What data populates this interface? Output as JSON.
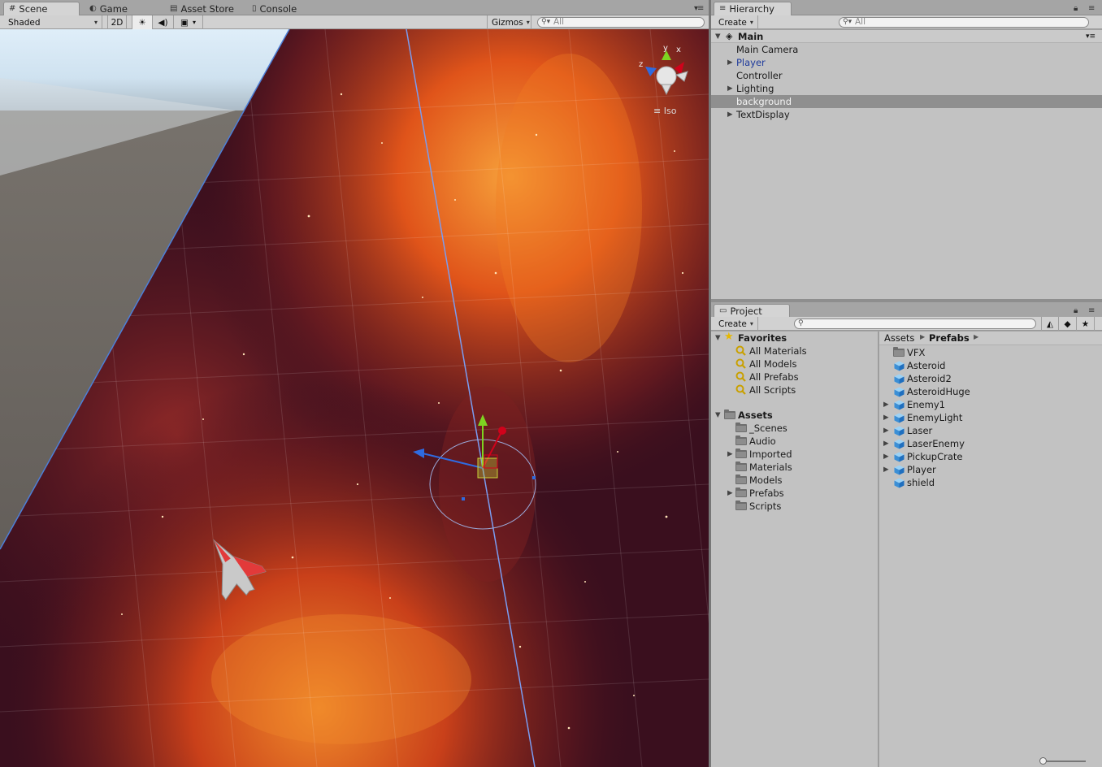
{
  "scene_tabs": {
    "scene": "Scene",
    "game": "Game",
    "asset_store": "Asset Store",
    "console": "Console"
  },
  "scene_toolbar": {
    "shading_mode": "Shaded",
    "mode_2d": "2D",
    "gizmos": "Gizmos",
    "search_placeholder": "All"
  },
  "scene_view": {
    "projection_label": "Iso",
    "axis_labels": {
      "x": "x",
      "y": "y",
      "z": "z"
    }
  },
  "hierarchy": {
    "tab": "Hierarchy",
    "create": "Create",
    "search_placeholder": "All",
    "scene_name": "Main",
    "items": [
      {
        "label": "Main Camera",
        "expandable": false,
        "selected": false,
        "prefab": false
      },
      {
        "label": "Player",
        "expandable": true,
        "selected": false,
        "prefab": true
      },
      {
        "label": "Controller",
        "expandable": false,
        "selected": false,
        "prefab": false
      },
      {
        "label": "Lighting",
        "expandable": true,
        "selected": false,
        "prefab": false
      },
      {
        "label": "background",
        "expandable": false,
        "selected": true,
        "prefab": false
      },
      {
        "label": "TextDisplay",
        "expandable": true,
        "selected": false,
        "prefab": false
      }
    ]
  },
  "project": {
    "tab": "Project",
    "create": "Create",
    "favorites_label": "Favorites",
    "favorites": [
      "All Materials",
      "All Models",
      "All Prefabs",
      "All Scripts"
    ],
    "assets_label": "Assets",
    "asset_folders": [
      {
        "label": "_Scenes",
        "expandable": false
      },
      {
        "label": "Audio",
        "expandable": false
      },
      {
        "label": "Imported",
        "expandable": true
      },
      {
        "label": "Materials",
        "expandable": false
      },
      {
        "label": "Models",
        "expandable": false
      },
      {
        "label": "Prefabs",
        "expandable": true
      },
      {
        "label": "Scripts",
        "expandable": false
      }
    ],
    "breadcrumb": [
      "Assets",
      "Prefabs"
    ],
    "contents": [
      {
        "label": "VFX",
        "kind": "folder",
        "expandable": false
      },
      {
        "label": "Asteroid",
        "kind": "prefab",
        "expandable": false
      },
      {
        "label": "Asteroid2",
        "kind": "prefab",
        "expandable": false
      },
      {
        "label": "AsteroidHuge",
        "kind": "prefab",
        "expandable": false
      },
      {
        "label": "Enemy1",
        "kind": "prefab",
        "expandable": true
      },
      {
        "label": "EnemyLight",
        "kind": "prefab",
        "expandable": true
      },
      {
        "label": "Laser",
        "kind": "prefab",
        "expandable": true
      },
      {
        "label": "LaserEnemy",
        "kind": "prefab",
        "expandable": true
      },
      {
        "label": "PickupCrate",
        "kind": "prefab",
        "expandable": true
      },
      {
        "label": "Player",
        "kind": "prefab",
        "expandable": true
      },
      {
        "label": "shield",
        "kind": "prefab",
        "expandable": false
      }
    ]
  },
  "colors": {
    "nebula_dark": "#3a0f1e",
    "nebula_orange": "#e0541a",
    "gizmo_green": "#7ed321",
    "gizmo_red": "#d0021b",
    "gizmo_blue": "#2f6be0",
    "selection": "#8f8f8f",
    "prefab_text": "#1e3a9c"
  }
}
